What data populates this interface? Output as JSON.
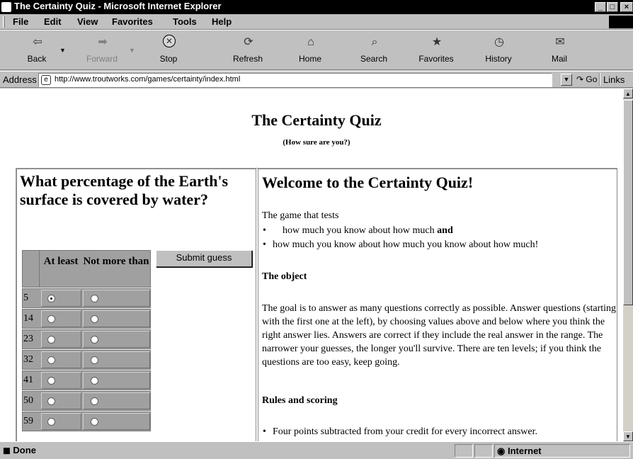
{
  "window": {
    "title": "The Certainty Quiz - Microsoft Internet Explorer",
    "buttons": [
      "_",
      "□",
      "×"
    ]
  },
  "menubar": {
    "items": [
      "File",
      "Edit",
      "View",
      "Favorites",
      "Tools",
      "Help"
    ]
  },
  "toolbar": {
    "buttons": [
      {
        "label": "Back",
        "icon": "back-arrow-icon",
        "enabled": true
      },
      {
        "label": "Forward",
        "icon": "forward-arrow-icon",
        "enabled": false
      },
      {
        "label": "Stop",
        "icon": "stop-icon",
        "enabled": true
      },
      {
        "label": "Refresh",
        "icon": "refresh-icon",
        "enabled": true
      },
      {
        "label": "Home",
        "icon": "home-icon",
        "enabled": true
      },
      {
        "label": "Search",
        "icon": "search-icon",
        "enabled": true
      },
      {
        "label": "Favorites",
        "icon": "favorites-icon",
        "enabled": true
      },
      {
        "label": "History",
        "icon": "history-icon",
        "enabled": true
      },
      {
        "label": "Mail",
        "icon": "mail-icon",
        "enabled": true
      }
    ]
  },
  "address": {
    "label": "Address",
    "url": "http://www.troutworks.com/games/certainty/index.html",
    "go": "Go",
    "links": "Links"
  },
  "page": {
    "title": "The Certainty Quiz",
    "subtitle": "(How sure are you?)",
    "question": "What percentage of the Earth's surface is covered by water?",
    "columns": [
      "At least",
      "Not more than"
    ],
    "rows": [
      {
        "value": "5",
        "at_least_checked": true,
        "not_more_checked": false
      },
      {
        "value": "14",
        "at_least_checked": false,
        "not_more_checked": false
      },
      {
        "value": "23",
        "at_least_checked": false,
        "not_more_checked": false
      },
      {
        "value": "32",
        "at_least_checked": false,
        "not_more_checked": false
      },
      {
        "value": "41",
        "at_least_checked": false,
        "not_more_checked": false
      },
      {
        "value": "50",
        "at_least_checked": false,
        "not_more_checked": false
      },
      {
        "value": "59",
        "at_least_checked": false,
        "not_more_checked": false
      }
    ],
    "submit_label": "Submit guess",
    "welcome": "Welcome to the Certainty Quiz!",
    "intro": "The game that tests",
    "bullets": [
      {
        "text": "how much you know about how much ",
        "bold": "and"
      },
      {
        "text": "how much you know about how much you know about how much!",
        "bold": ""
      }
    ],
    "object_heading": "The object",
    "object_text": "The goal is to answer as many questions correctly as possible. Answer questions (starting with the first one at the left), by choosing values above and below where you think the right answer lies. Answers are correct if they include the real answer in the range. The narrower your guesses, the longer you'll survive. There are ten levels; if you think the questions are too easy, keep going.",
    "rules_heading": "Rules and scoring",
    "rules_bullet": "Four points subtracted from your credit for every incorrect answer."
  },
  "status": {
    "text": "Done",
    "zone": "Internet"
  }
}
